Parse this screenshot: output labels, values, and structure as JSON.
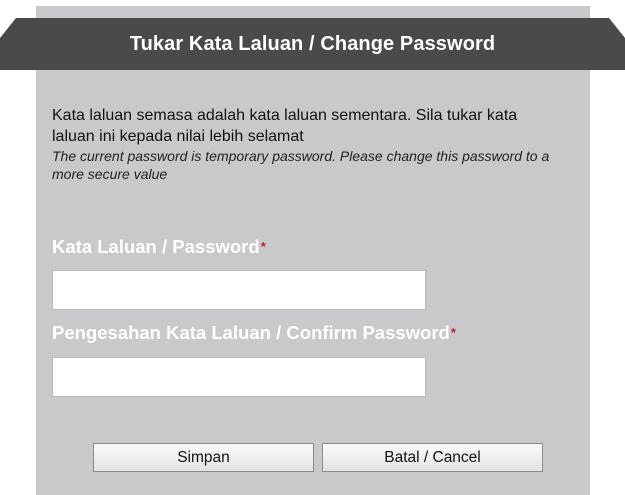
{
  "dialog": {
    "title": "Tukar Kata Laluan / Change Password",
    "message_ms": "Kata laluan semasa adalah kata laluan sementara. Sila tukar kata laluan ini kepada nilai lebih selamat",
    "message_en": "The current password is temporary password. Please change this password to a more secure value"
  },
  "form": {
    "password_label": "Kata Laluan / Password",
    "confirm_label": "Pengesahan Kata Laluan / Confirm Password",
    "required_marker": "*",
    "password_value": "",
    "confirm_value": ""
  },
  "buttons": {
    "save_label": "Simpan",
    "cancel_label": "Batal / Cancel"
  },
  "colors": {
    "panel_bg": "#c8c9cb",
    "header_bg": "#4a4a4a",
    "label_text": "#ffffff",
    "required": "#cc2222"
  }
}
